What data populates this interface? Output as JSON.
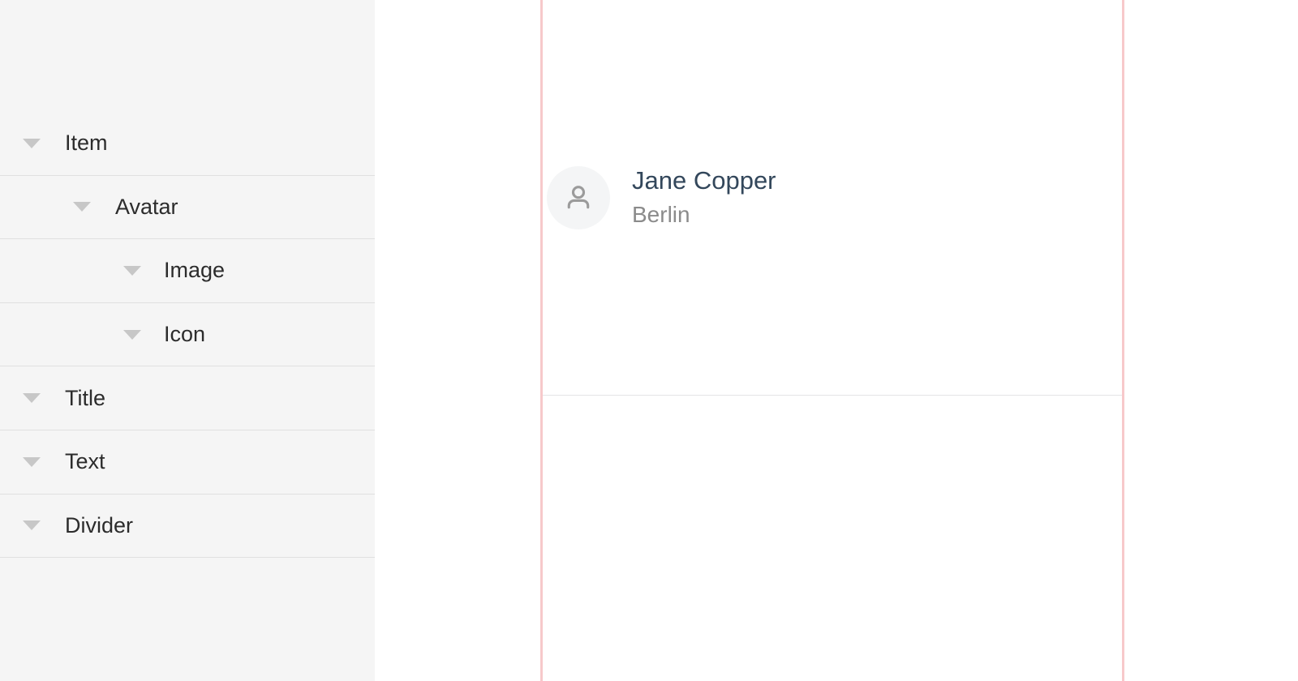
{
  "tree": {
    "items": [
      {
        "label": "Item",
        "level": 0,
        "expanded": true,
        "twisty": "triangle-down-icon"
      },
      {
        "label": "Avatar",
        "level": 1,
        "expanded": true,
        "twisty": "triangle-down-icon"
      },
      {
        "label": "Image",
        "level": 2,
        "expanded": true,
        "twisty": "triangle-down-icon"
      },
      {
        "label": "Icon",
        "level": 2,
        "expanded": true,
        "twisty": "triangle-down-icon"
      },
      {
        "label": "Title",
        "level": 0,
        "expanded": true,
        "twisty": "triangle-down-icon"
      },
      {
        "label": "Text",
        "level": 0,
        "expanded": true,
        "twisty": "triangle-down-icon"
      },
      {
        "label": "Divider",
        "level": 0,
        "expanded": true,
        "twisty": "triangle-down-icon"
      }
    ]
  },
  "canvas": {
    "card": {
      "avatar_icon": "user-person-icon",
      "title": "Jane Copper",
      "subtitle": "Berlin"
    }
  },
  "colors": {
    "panel_background": "#f5f5f5",
    "row_separator": "#e0e0e0",
    "twisty": "#c7c7c7",
    "row_label": "#2c2c2c",
    "canvas_background": "#ffffff",
    "guide_line": "#f7c9cb",
    "card_divider": "#e4e4e6",
    "avatar_background": "#f4f5f6",
    "avatar_icon": "#9b9b9b",
    "card_title": "#33475b",
    "card_subtitle": "#8b8b8b"
  }
}
